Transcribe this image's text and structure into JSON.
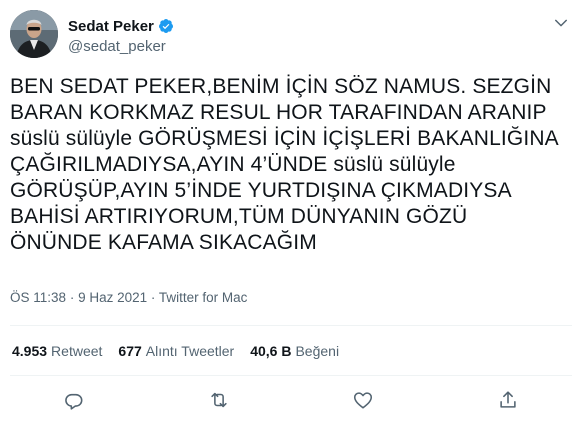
{
  "author": {
    "display_name": "Sedat Peker",
    "handle": "@sedat_peker",
    "verified": true
  },
  "tweet": {
    "text": "BEN SEDAT PEKER,BENİM İÇİN SÖZ NAMUS. SEZGİN\nBARAN KORKMAZ RESUL HOR TARAFINDAN ARANIP\nsüslü sülüyle GÖRÜŞMESİ İÇİN İÇİŞLERİ BAKANLIĞINA\nÇAĞIRILMADIYSA,AYIN 4’ÜNDE süslü sülüyle\nGÖRÜŞÜP,AYIN 5’İNDE YURTDIŞINA ÇIKMADIYSA\nBAHİSİ ARTIRIYORUM,TÜM DÜNYANIN GÖZÜ\nÖNÜNDE KAFAMA SIKACAĞIM",
    "time": "ÖS 11:38",
    "separator": "·",
    "date": "9 Haz 2021",
    "source": "Twitter for Mac"
  },
  "stats": {
    "retweets_count": "4.953",
    "retweets_label": "Retweet",
    "quotes_count": "677",
    "quotes_label": "Alıntı Tweetler",
    "likes_count": "40,6 B",
    "likes_label": "Beğeni"
  },
  "icons": {
    "verified": "verified-badge-icon",
    "more": "chevron-down-icon",
    "reply": "reply-icon",
    "retweet": "retweet-icon",
    "like": "heart-icon",
    "share": "share-icon"
  },
  "colors": {
    "verified": "#1d9bf0",
    "text": "#0f1419",
    "muted": "#536471",
    "divider": "#eff3f4"
  }
}
